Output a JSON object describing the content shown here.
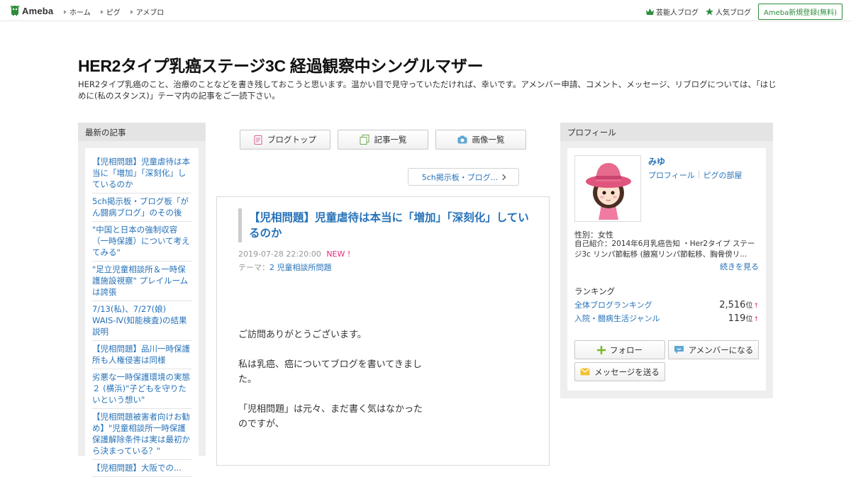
{
  "topbar": {
    "logo_text": "Ameba",
    "nav": [
      "ホーム",
      "ピグ",
      "アメブロ"
    ],
    "celebrity_label": "芸能人ブログ",
    "popular_label": "人気ブログ",
    "register_label": "Ameba新規登録(無料)"
  },
  "header": {
    "title": "HER2タイプ乳癌ステージ3C 経過観察中シングルマザー",
    "description": "HER2タイプ乳癌のこと、治療のことなどを書き残しておこうと思います。温かい目で見守っていただければ、幸いです。アメンバー申請、コメント、メッセージ、リブログについては、「はじめに(私のスタンス)」テーマ内の記事をご一読下さい。"
  },
  "sidebar_left": {
    "heading": "最新の記事",
    "items": [
      "【児相問題】児童虐待は本当に「増加」「深刻化」しているのか",
      "5ch掲示板・ブログ板「がん闘病ブログ」のその後",
      "\"中国と日本の強制収容（一時保護）について考えてみる\"",
      "\"足立児童相談所＆一時保護施設視察\" プレイルームは誇張",
      "7/13(私)、7/27(娘) WAIS-Ⅳ(知能検査)の結果説明",
      "【児相問題】品川一時保護所も人権侵害は同様",
      "劣悪な一時保護環境の実態２ (横浜)\"子どもを守りたいという想い\"",
      "【児相問題被害者向けお勧め】\"児童相談所一時保護保護解除条件は実は最初から決まっている？\"",
      "【児相問題】大阪での..."
    ]
  },
  "main": {
    "tabs": [
      "ブログトップ",
      "記事一覧",
      "画像一覧"
    ],
    "next_label": "5ch掲示板・ブログ...",
    "article": {
      "title": "【児相問題】児童虐待は本当に「増加」「深刻化」しているのか",
      "datetime": "2019-07-28 22:20:00",
      "new_badge": "NEW !",
      "theme_prefix": "テーマ：",
      "theme": "2 児童相談所問題",
      "paragraphs": [
        "ご訪問ありがとうございます。",
        "私は乳癌、癌についてブログを書いてきました。",
        "「児相問題」は元々、まだ書く気はなかったのですが、"
      ]
    }
  },
  "sidebar_right": {
    "heading": "プロフィール",
    "name": "みゆ",
    "profile_link": "プロフィール",
    "pigg_link": "ピグの部屋",
    "gender": "性別：女性",
    "intro": "自己紹介：2014年6月乳癌告知 ・Her2タイプ ステージ3c リンパ節転移 (腋窩リンパ節転移、胸骨傍リ...",
    "more_label": "続きを見る",
    "ranking_label": "ランキング",
    "rankings": [
      {
        "name": "全体ブログランキング",
        "value": "2,516",
        "unit": "位",
        "trend": "↑"
      },
      {
        "name": "入院・闘病生活ジャンル",
        "value": "119",
        "unit": "位",
        "trend": "↑"
      }
    ],
    "follow_label": "フォロー",
    "amember_label": "アメンバーになる",
    "message_label": "メッセージを送る"
  },
  "colors": {
    "link": "#2672b9",
    "new_badge": "#e4287c",
    "brand_green": "#2d8c3c"
  }
}
